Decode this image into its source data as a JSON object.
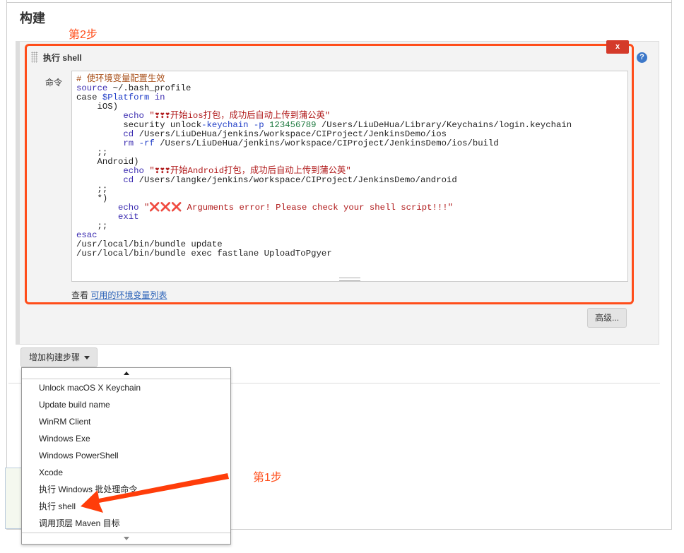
{
  "section_title": "构建",
  "annotations": {
    "step2": "第2步",
    "step1": "第1步"
  },
  "colors": {
    "annotation": "#ff4d1a",
    "close": "#d43a2a",
    "link": "#2a62b8"
  },
  "step": {
    "title": "执行 shell",
    "close_label": "x",
    "help_label": "?",
    "command_label": "命令",
    "view_prefix": "查看",
    "view_link": "可用的环境变量列表",
    "advanced_label": "高级..."
  },
  "code_lines": [
    [
      [
        "# 使环境变量配置生效",
        "cm"
      ]
    ],
    [
      [
        "source",
        "kw"
      ],
      [
        " ~/.bash_profile",
        ""
      ]
    ],
    [
      [
        "case ",
        ""
      ],
      [
        "$Platform",
        "vr"
      ],
      [
        " in",
        "kw"
      ]
    ],
    [
      [
        "    iOS)",
        ""
      ]
    ],
    [
      [
        "         ",
        ""
      ],
      [
        "echo",
        "kw"
      ],
      [
        " \"❣❣❣开始ios打包，成功后自动上传到蒲公英\"",
        "st"
      ]
    ],
    [
      [
        "         security unlock",
        ""
      ],
      [
        "-keychain",
        "fl"
      ],
      [
        " ",
        ""
      ],
      [
        "-p",
        "fl"
      ],
      [
        " ",
        ""
      ],
      [
        "123456789",
        "nm"
      ],
      [
        " /Users/LiuDeHua/Library/Keychains/login.keychain",
        ""
      ]
    ],
    [
      [
        "         ",
        ""
      ],
      [
        "cd",
        "kw"
      ],
      [
        " /Users/LiuDeHua/jenkins/workspace/CIProject/JenkinsDemo/ios",
        ""
      ]
    ],
    [
      [
        "         ",
        ""
      ],
      [
        "rm",
        "kw"
      ],
      [
        " ",
        ""
      ],
      [
        "-rf",
        "fl"
      ],
      [
        " /Users/LiuDeHua/jenkins/workspace/CIProject/JenkinsDemo/ios/build",
        ""
      ]
    ],
    [
      [
        "    ;;",
        ""
      ]
    ],
    [
      [
        "    Android)",
        ""
      ]
    ],
    [
      [
        "         ",
        ""
      ],
      [
        "echo",
        "kw"
      ],
      [
        " \"❣❣❣开始Android打包，成功后自动上传到蒲公英\"",
        "st"
      ]
    ],
    [
      [
        "         ",
        ""
      ],
      [
        "cd",
        "kw"
      ],
      [
        " /Users/langke/jenkins/workspace/CIProject/JenkinsDemo/android",
        ""
      ]
    ],
    [
      [
        "    ;;",
        ""
      ]
    ],
    [
      [
        "    *)",
        ""
      ]
    ],
    [
      [
        "        ",
        ""
      ],
      [
        "echo",
        "kw"
      ],
      [
        " \"❌❌❌ Arguments error! Please check your shell script!!!\"",
        "st"
      ]
    ],
    [
      [
        "        ",
        ""
      ],
      [
        "exit",
        "kw"
      ]
    ],
    [
      [
        "    ;;",
        ""
      ]
    ],
    [
      [
        "esac",
        "kw"
      ]
    ],
    [
      [
        "/usr/local/bin/bundle update",
        ""
      ]
    ],
    [
      [
        "/usr/local/bin/bundle exec fastlane UploadToPgyer",
        ""
      ]
    ]
  ],
  "add_step_label": "增加构建步骤",
  "dropdown_items": [
    "Unlock macOS X Keychain",
    "Update build name",
    "WinRM Client",
    "Windows Exe",
    "Windows PowerShell",
    "Xcode",
    "执行 Windows 批处理命令",
    "执行 shell",
    "调用顶层 Maven 目标"
  ]
}
